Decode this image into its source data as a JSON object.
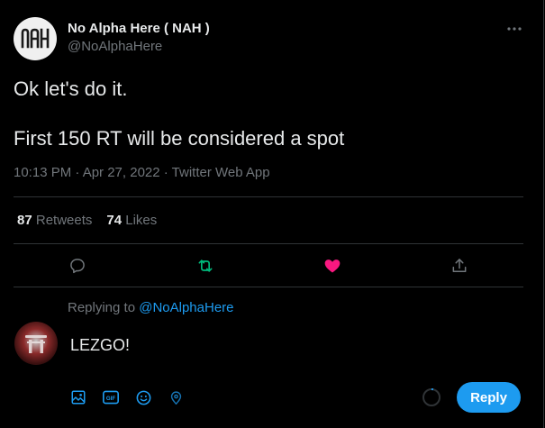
{
  "tweet": {
    "author_name": "No Alpha Here ( NAH )",
    "author_handle": "@NoAlphaHere",
    "avatar_text": "NAH",
    "text_line1": "Ok let's do it.",
    "text_line2": "First 150 RT will be considered a spot",
    "meta": "10:13 PM · Apr 27, 2022 · Twitter Web App",
    "retweets_count": "87",
    "retweets_label": "Retweets",
    "likes_count": "74",
    "likes_label": "Likes",
    "liked": true
  },
  "actions": {
    "reply_icon": "comment-icon",
    "retweet_icon": "retweet-icon",
    "like_icon": "heart-filled-icon",
    "share_icon": "share-icon"
  },
  "reply": {
    "replying_to_prefix": "Replying to",
    "replying_to_handle": "@NoAlphaHere",
    "text": "LEZGO!",
    "button_label": "Reply",
    "toolbar_icons": [
      "media-icon",
      "gif-icon",
      "emoji-icon",
      "location-icon"
    ]
  },
  "colors": {
    "background": "#000000",
    "accent": "#1d9bf0",
    "retweet_green": "#00ba7c",
    "like_pink": "#f91880",
    "muted": "#71767b",
    "text": "#e7e9ea",
    "divider": "#2f3336"
  }
}
